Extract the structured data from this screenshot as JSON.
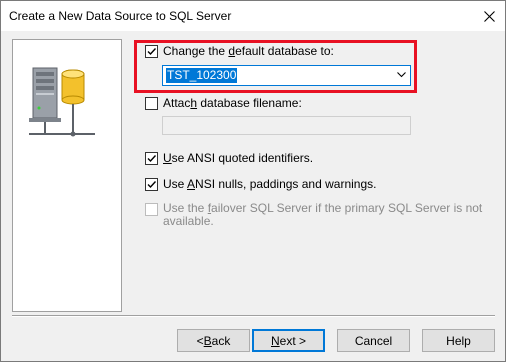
{
  "window": {
    "title": "Create a New Data Source to SQL Server"
  },
  "options": {
    "change_default_db": {
      "label_pre": "Change the ",
      "label_key": "d",
      "label_post": "efault database to:",
      "checked": true
    },
    "database_value": "TST_102300",
    "attach_db": {
      "label_pre": "Attac",
      "label_key": "h",
      "label_post": " database filename:",
      "checked": false,
      "value": ""
    },
    "ansi_quoted": {
      "label_key": "U",
      "label_post": "se ANSI quoted identifiers.",
      "checked": true
    },
    "ansi_nulls": {
      "label_pre": "Use ",
      "label_key": "A",
      "label_post": "NSI nulls, paddings and warnings.",
      "checked": true
    },
    "failover": {
      "line1_pre": "Use the ",
      "line1_key": "f",
      "line1_post": "ailover SQL Server if the primary SQL Server is not",
      "line2": "available.",
      "checked": false,
      "enabled": false
    }
  },
  "buttons": {
    "back": {
      "pre": "< ",
      "key": "B",
      "post": "ack"
    },
    "next": {
      "key": "N",
      "post": "ext >"
    },
    "cancel": "Cancel",
    "help": "Help"
  },
  "colors": {
    "highlight": "#e81123",
    "accent": "#0078d7"
  },
  "icons": {
    "close": "close-icon",
    "server": "database-server-icon",
    "check": "checkmark-icon",
    "dropdown": "chevron-down-icon"
  }
}
